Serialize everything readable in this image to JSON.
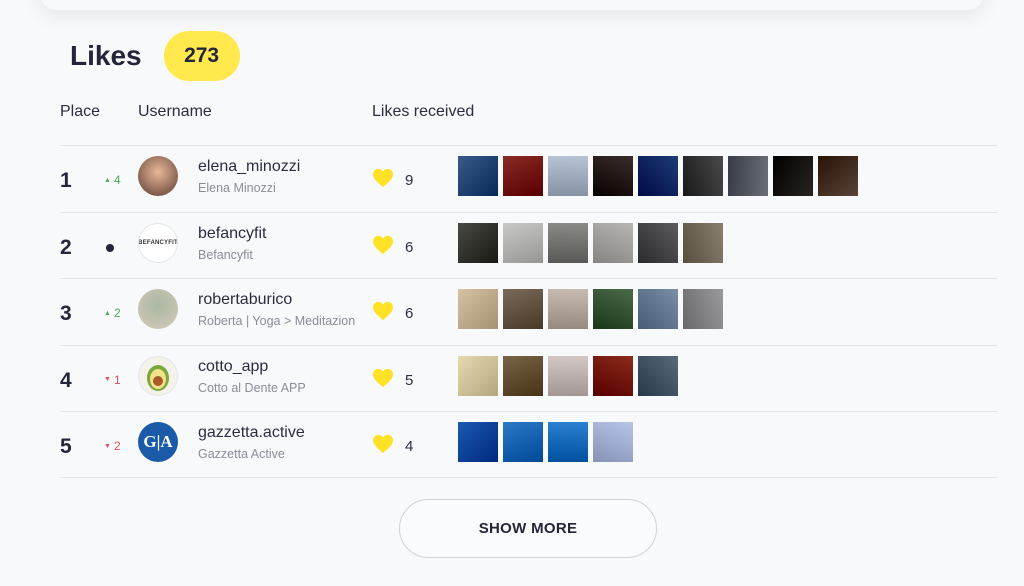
{
  "header": {
    "title": "Likes",
    "count": "273"
  },
  "columns": {
    "place": "Place",
    "username": "Username",
    "likes_received": "Likes received"
  },
  "rows": [
    {
      "place": "1",
      "trend": "up",
      "trend_value": "4",
      "username": "elena_minozzi",
      "full_name": "Elena Minozzi",
      "likes": "9",
      "avatar": {
        "colors": [
          "#e8b89a",
          "#5a3a2e"
        ],
        "text": ""
      },
      "thumbs": [
        "#3a5a8a",
        "#8a2a24",
        "#b8c4d6",
        "#3a2e2a",
        "#1e3c78",
        "#4a4a4a",
        "#6a6e78",
        "#2a2420",
        "#5a4438"
      ]
    },
    {
      "place": "2",
      "trend": "same",
      "trend_value": "",
      "username": "befancyfit",
      "full_name": "Befancyfit",
      "likes": "6",
      "avatar": {
        "colors": [
          "#ffffff",
          "#ffffff"
        ],
        "text": "BEFANCYFIT"
      },
      "thumbs": [
        "#4a4a44",
        "#c8c8c6",
        "#8a8a88",
        "#b8b6b2",
        "#5c5c5e",
        "#8a8070"
      ]
    },
    {
      "place": "3",
      "trend": "up",
      "trend_value": "2",
      "username": "robertaburico",
      "full_name": "Roberta | Yoga > Meditazion",
      "likes": "6",
      "avatar": {
        "colors": [
          "#a8b8a4",
          "#d8c8b8"
        ],
        "text": ""
      },
      "thumbs": [
        "#d8c2a4",
        "#7a6a5a",
        "#c8bcb2",
        "#4a6a4a",
        "#7a8ea8",
        "#9a9a9e"
      ]
    },
    {
      "place": "4",
      "trend": "down",
      "trend_value": "1",
      "username": "cotto_app",
      "full_name": "Cotto al Dente APP",
      "likes": "5",
      "avatar": {
        "colors": [
          "#f4f2ea",
          "#f4f2ea"
        ],
        "text": ""
      },
      "thumbs": [
        "#e6d8b0",
        "#7a6448",
        "#d4c8c4",
        "#8a2a1a",
        "#5a6a7a"
      ]
    },
    {
      "place": "5",
      "trend": "down",
      "trend_value": "2",
      "username": "gazzetta.active",
      "full_name": "Gazzetta Active",
      "likes": "4",
      "avatar": {
        "colors": [
          "#1a5aa8",
          "#1a5aa8"
        ],
        "text": "G|A"
      },
      "thumbs": [
        "#1a5ab0",
        "#2a7ac8",
        "#2a82d0",
        "#b8c4e8"
      ]
    }
  ],
  "show_more_label": "SHOW MORE",
  "colors": {
    "accent": "#ffe94d",
    "up": "#4cae5b",
    "down": "#e0505a",
    "heart": "#ffe225"
  }
}
